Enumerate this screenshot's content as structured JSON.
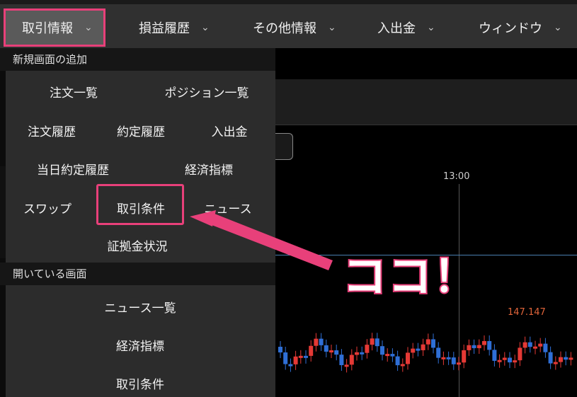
{
  "menubar": {
    "items": [
      {
        "label": "取引情報",
        "active": true
      },
      {
        "label": "損益履歴"
      },
      {
        "label": "その他情報"
      },
      {
        "label": "入出金"
      },
      {
        "label": "ウィンドウ"
      }
    ]
  },
  "dropdown": {
    "new_section": {
      "heading": "新規画面の追加",
      "items": [
        "注文一覧",
        "ポジション一覧",
        "注文履歴",
        "約定履歴",
        "入出金",
        "当日約定履歴",
        "経済指標",
        "スワップ",
        "取引条件",
        "ニュース",
        "証拠金状況"
      ]
    },
    "open_section": {
      "heading": "開いている画面",
      "items": [
        "ニュース一覧",
        "経済指標",
        "取引条件"
      ]
    }
  },
  "chart": {
    "time_label": "13:00",
    "price_label": "147.147"
  },
  "annotation": {
    "callout": "ココ！"
  },
  "colors": {
    "accent": "#e8407a",
    "up_candle": "#e53935",
    "down_candle": "#2f6fd6"
  }
}
